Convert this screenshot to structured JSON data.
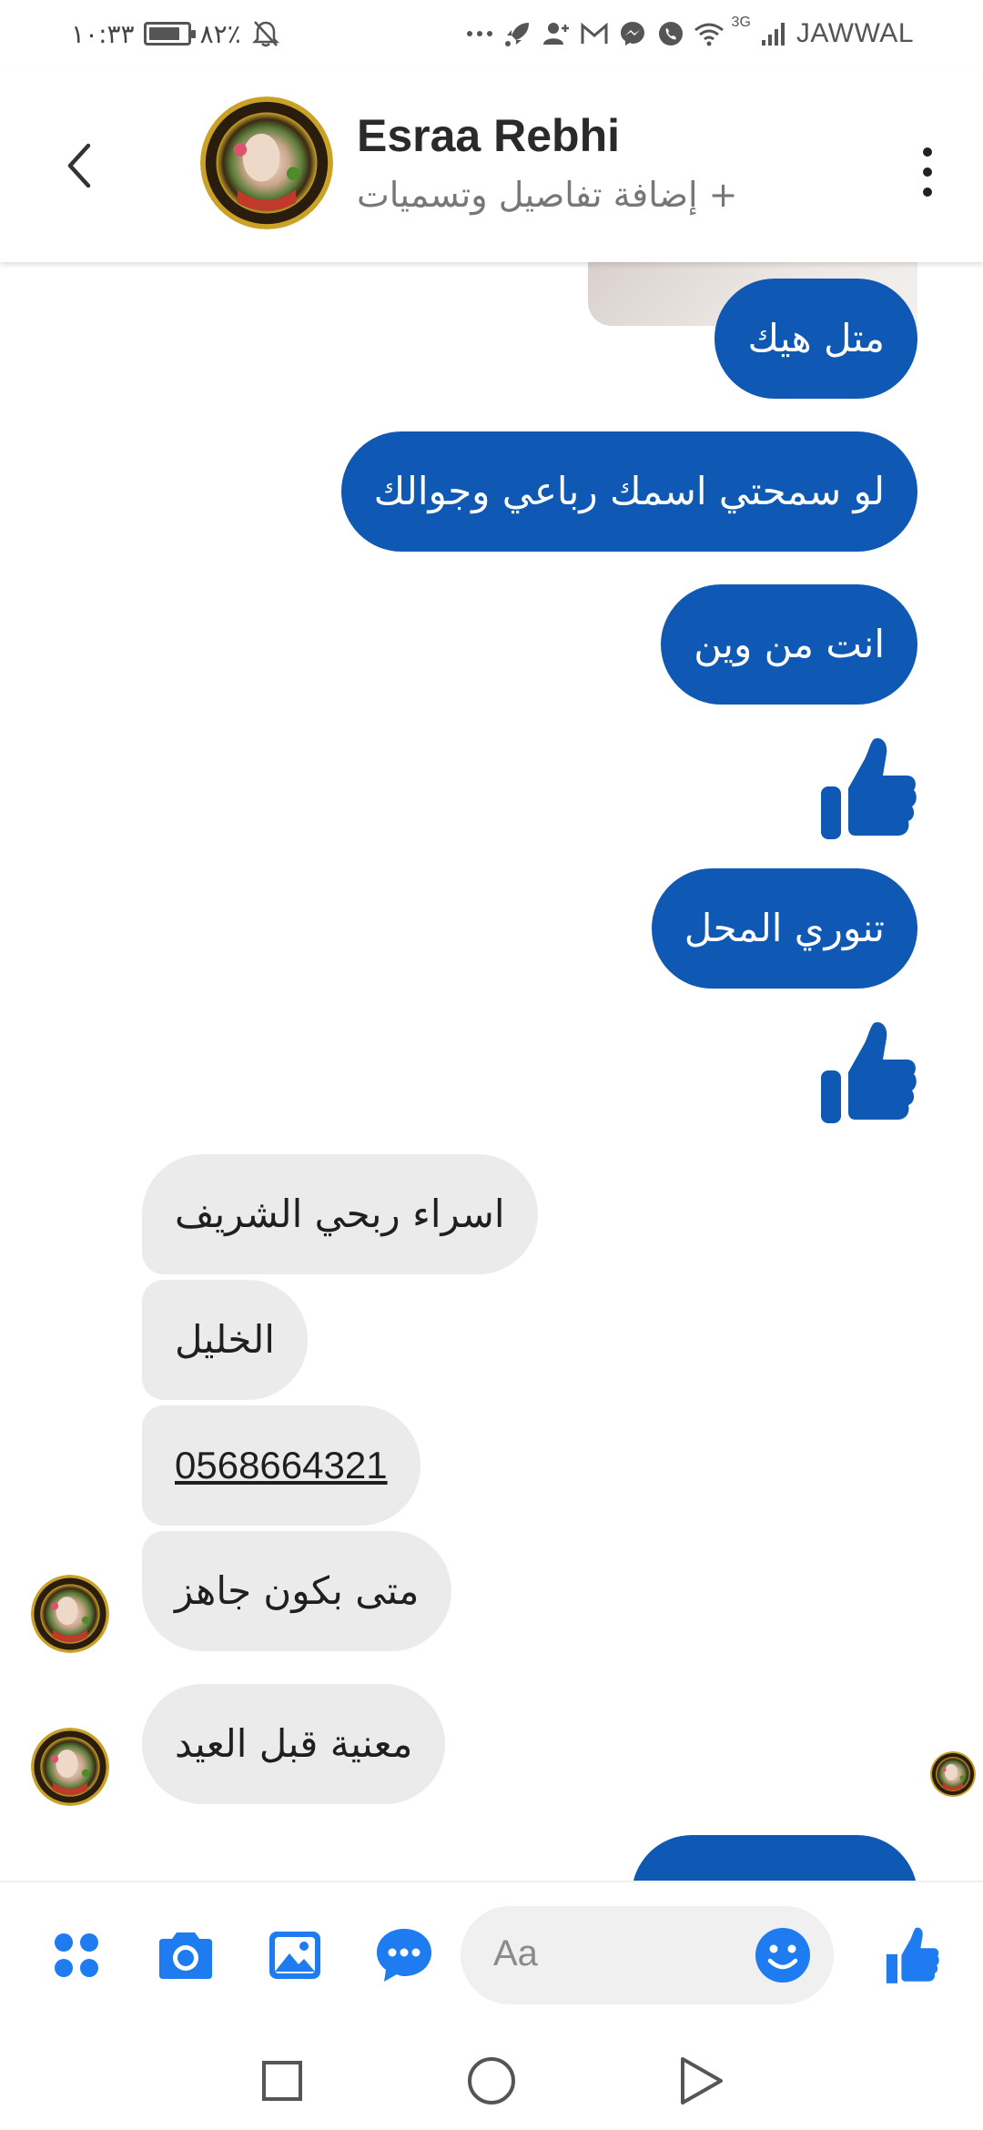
{
  "status_bar": {
    "time": "١٠:٣٣",
    "battery": "٨٢٪",
    "battery_level": 0.82,
    "network": "3G",
    "carrier": "JAWWAL",
    "icons": [
      "mute-bell-icon",
      "overflow-dots-icon",
      "rocket-icon",
      "add-person-icon",
      "gmail-icon",
      "messenger-icon",
      "whatsapp-icon",
      "wifi-icon",
      "signal-icon"
    ]
  },
  "header": {
    "contact_name": "Esraa Rebhi",
    "subtitle": "+ إضافة تفاصيل وتسميات",
    "avatar_caption": "Proud to be a teacher",
    "icons": [
      "back-chevron-icon",
      "vertical-dots-icon"
    ]
  },
  "messages": [
    {
      "direction": "out",
      "type": "text",
      "text": "متل هيك"
    },
    {
      "direction": "out",
      "type": "text",
      "text": "لو سمحتي اسمك رباعي وجوالك"
    },
    {
      "direction": "out",
      "type": "text",
      "text": "انت من وين"
    },
    {
      "direction": "out",
      "type": "like"
    },
    {
      "direction": "out",
      "type": "text",
      "text": "تنوري المحل"
    },
    {
      "direction": "out",
      "type": "like"
    },
    {
      "direction": "in",
      "type": "text",
      "text": "اسراء ربحي الشريف"
    },
    {
      "direction": "in",
      "type": "text",
      "text": "الخليل"
    },
    {
      "direction": "in",
      "type": "link",
      "text": "0568664321"
    },
    {
      "direction": "in",
      "type": "text",
      "text": "متى بكون جاهز"
    },
    {
      "direction": "in",
      "type": "text",
      "text": "معنية قبل العيد"
    }
  ],
  "composer": {
    "placeholder": "Aa",
    "icons": [
      "apps-grid-icon",
      "camera-icon",
      "gallery-icon",
      "chat-dots-icon",
      "emoji-icon",
      "like-icon"
    ]
  },
  "colors": {
    "outgoing_bubble": "#0f58b3",
    "incoming_bubble": "#ebebeb",
    "accent": "#1e7bf0"
  },
  "nav_bar": {
    "icons": [
      "recent-apps-square-icon",
      "home-circle-icon",
      "back-triangle-icon"
    ]
  }
}
